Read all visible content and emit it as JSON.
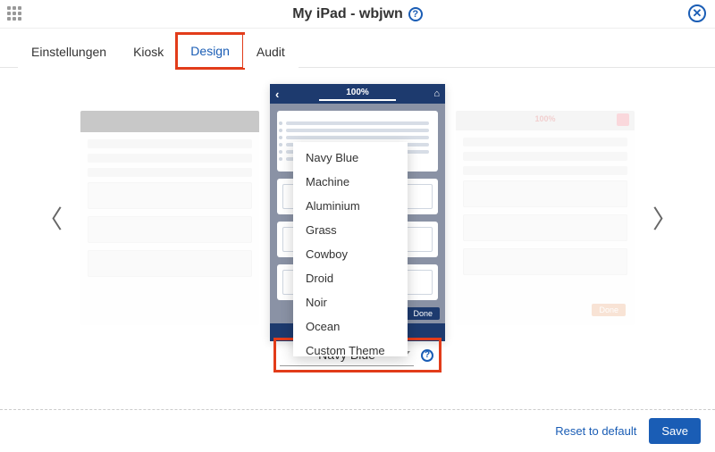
{
  "header": {
    "title": "My iPad - wbjwn"
  },
  "tabs": [
    {
      "label": "Einstellungen",
      "active": false
    },
    {
      "label": "Kiosk",
      "active": false
    },
    {
      "label": "Design",
      "active": true
    },
    {
      "label": "Audit",
      "active": false
    }
  ],
  "preview": {
    "progress_label": "100%",
    "side_progress_label": "100%",
    "done_label": "Done"
  },
  "theme_dropdown": {
    "selected": "Navy Blue",
    "options": [
      "Navy Blue",
      "Machine",
      "Aluminium",
      "Grass",
      "Cowboy",
      "Droid",
      "Noir",
      "Ocean",
      "Custom Theme"
    ]
  },
  "footer": {
    "reset_label": "Reset to default",
    "save_label": "Save"
  },
  "colors": {
    "accent": "#1a5db5",
    "highlight": "#e23c1a",
    "navy_header": "#1d3a6e"
  }
}
